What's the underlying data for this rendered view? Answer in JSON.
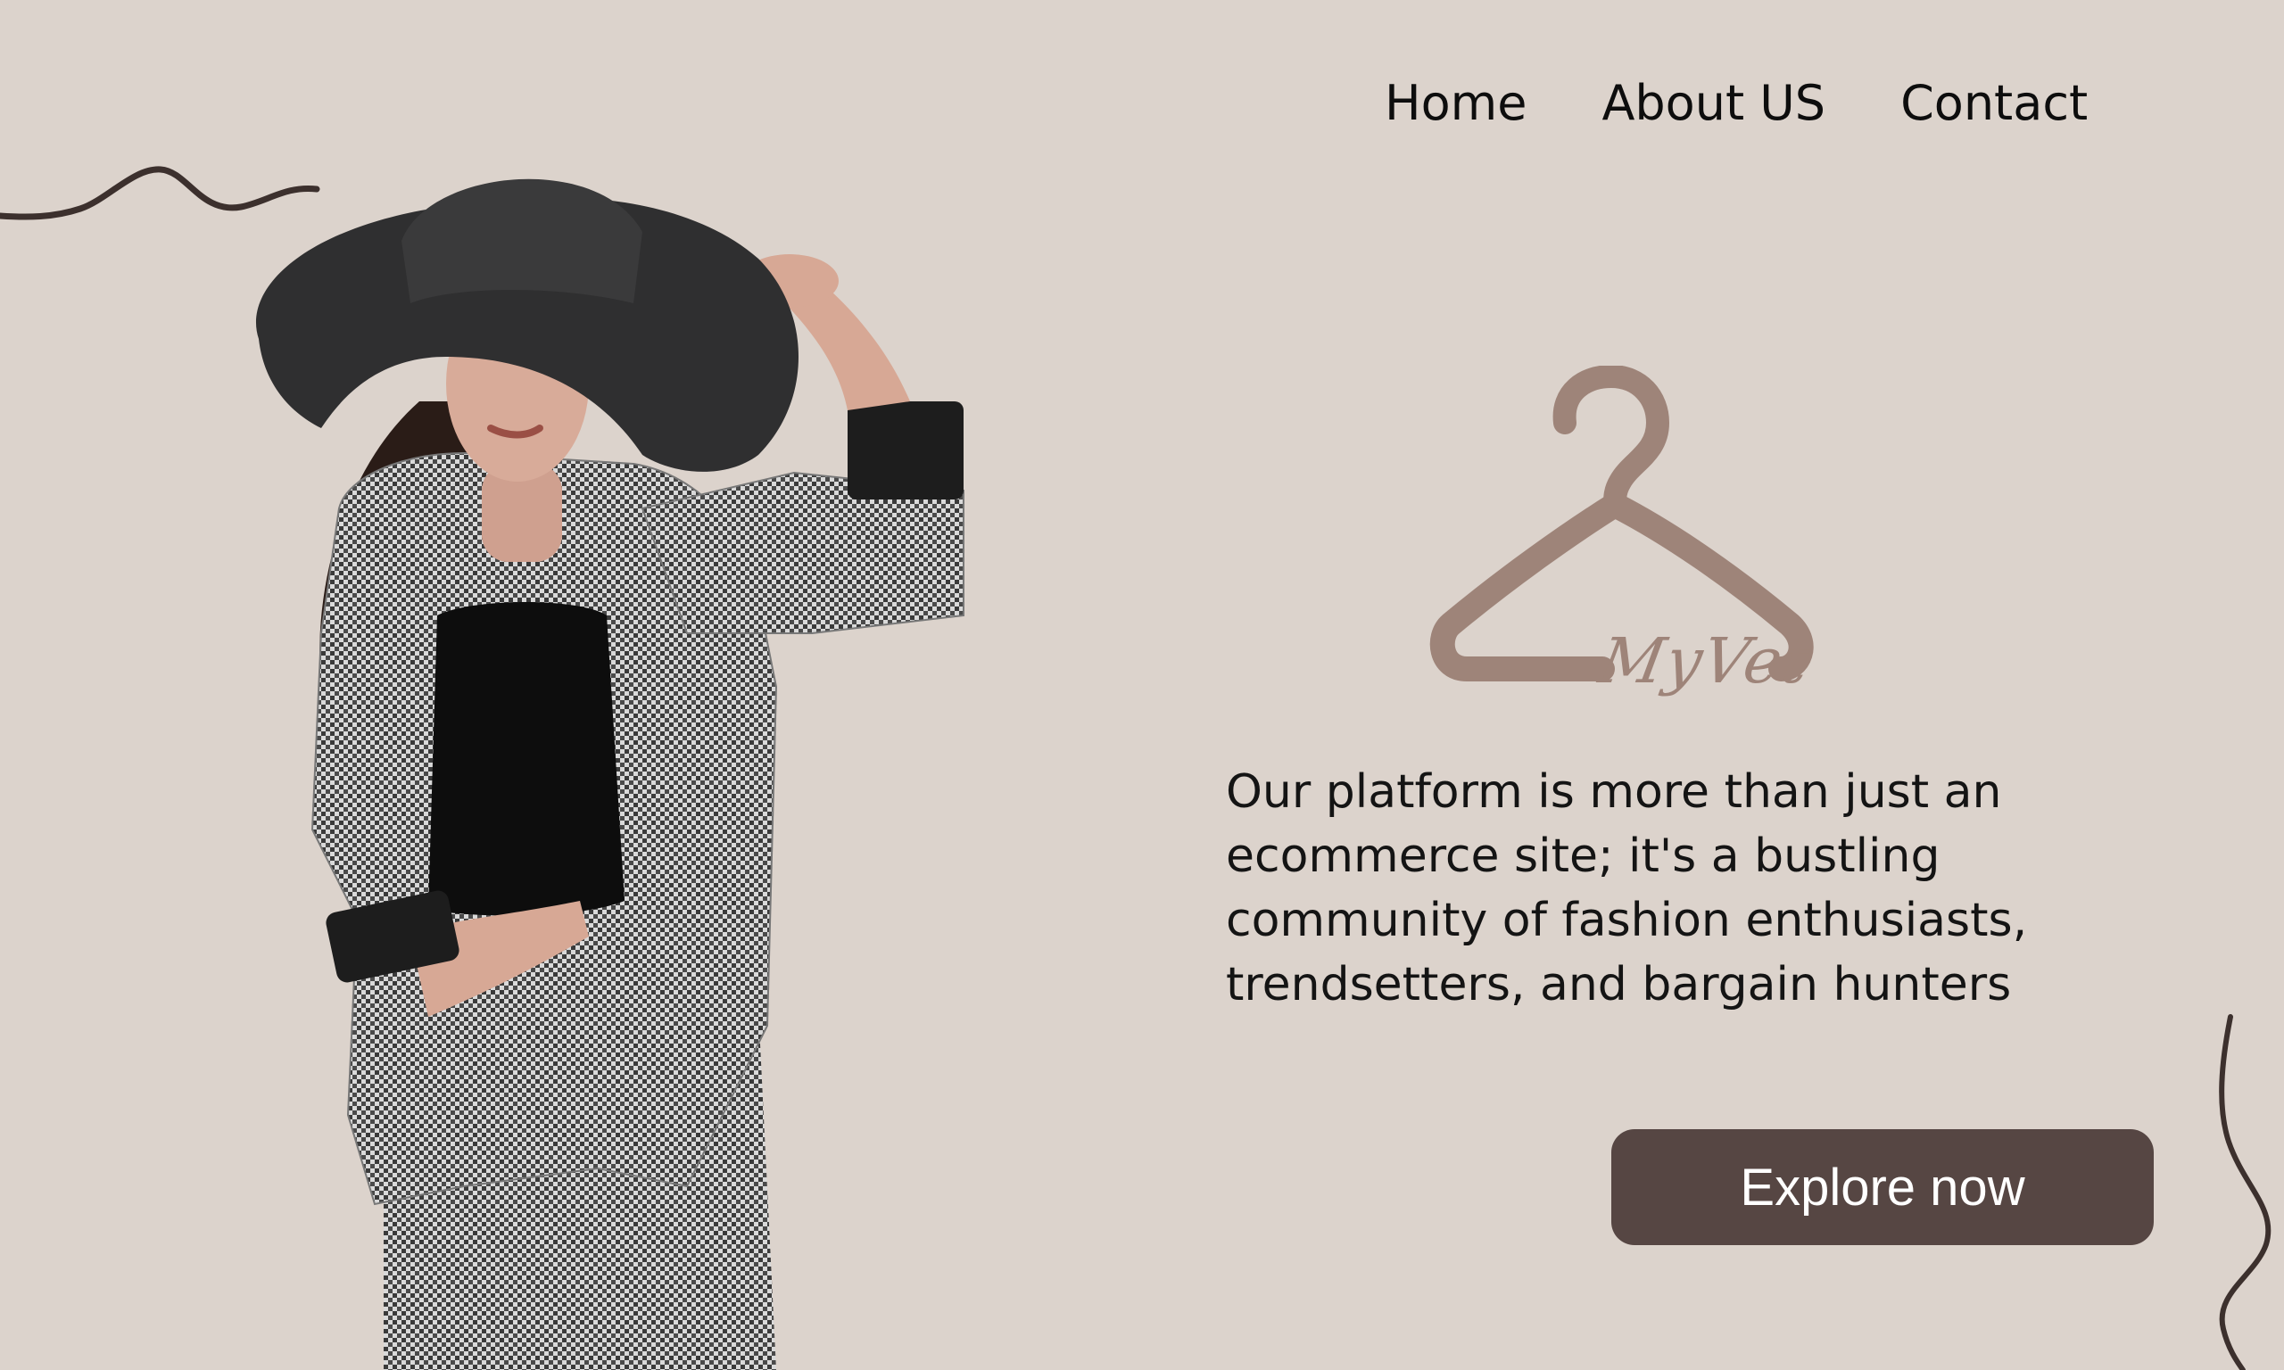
{
  "nav": {
    "items": [
      {
        "label": "Home"
      },
      {
        "label": "About US"
      },
      {
        "label": "Contact"
      }
    ]
  },
  "brand": {
    "name": "MyVet",
    "icon": "hanger-icon",
    "color": "#9e8479"
  },
  "hero": {
    "image": "model-in-wide-brim-hat-and-houndstooth-suit"
  },
  "tagline": "Our platform is more than just an ecommerce site; it's a bustling community of fashion enthusiasts, trendsetters, and bargain hunters",
  "cta": {
    "label": "Explore now",
    "color": "#564643"
  },
  "theme": {
    "background": "#dcd3cc",
    "squiggle": "#3c302d"
  }
}
